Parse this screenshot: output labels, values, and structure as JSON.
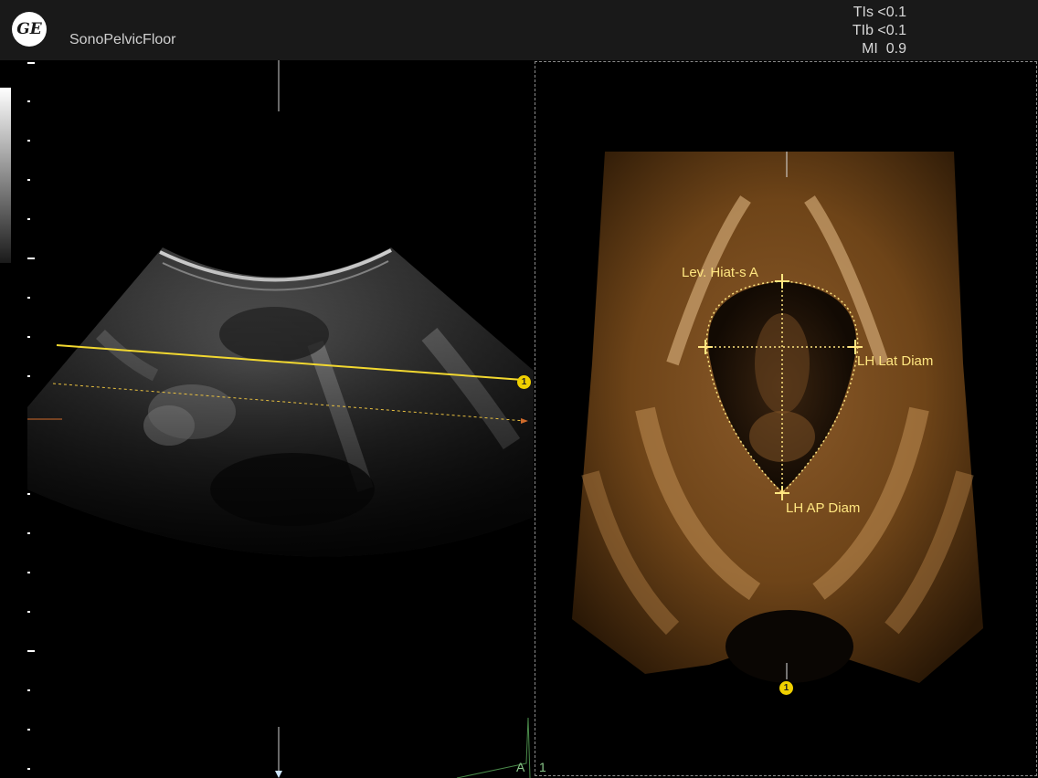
{
  "header": {
    "logo_text": "GE",
    "app_name": "SonoPelvicFloor"
  },
  "acoustic_output": [
    "TIs <0.1",
    "TIb <0.1",
    "MI  0.9"
  ],
  "measurements": {
    "hiatus_area": "Lev. Hiat-s A",
    "lateral_diameter": "LH Lat Diam",
    "ap_diameter": "LH AP Diam"
  },
  "markers": {
    "reference_marker_left": "1",
    "reference_marker_right": "1"
  },
  "plane_tags": {
    "left_plane": "A",
    "right_plane": "1"
  },
  "colors": {
    "background": "#000000",
    "header": "#191919",
    "caliper": "#ffe680",
    "marker": "#f0d000",
    "sepia": "#b07a3a"
  },
  "icons": {
    "logo": "ge-logo-icon",
    "caliper": "caliper-cross-icon",
    "marker": "reference-marker-icon"
  }
}
